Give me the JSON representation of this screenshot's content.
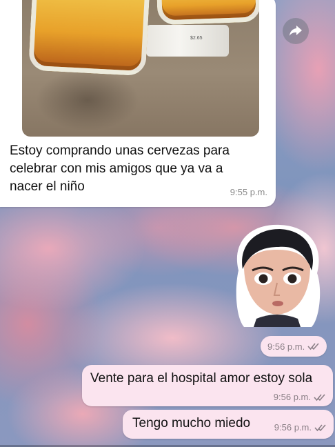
{
  "messages": {
    "incoming": {
      "text": "Estoy comprando unas cervezas para celebrar con mis amigos que ya va a nacer el niño",
      "time": "9:55 p.m.",
      "photo_label": "$2.65"
    },
    "sticker": {
      "time": "9:56 p.m."
    },
    "outgoing": [
      {
        "text": "Vente para el hospital amor estoy sola",
        "time": "9:56 p.m."
      },
      {
        "text": "Tengo mucho miedo",
        "time": "9:56 p.m."
      }
    ]
  },
  "icons": {
    "forward": "forward-arrow-icon",
    "read_receipt": "double-check-icon"
  },
  "colors": {
    "outgoing_bubble": "#fbe4ef",
    "incoming_bubble": "#ffffff",
    "timestamp": "#8a8a8a"
  }
}
